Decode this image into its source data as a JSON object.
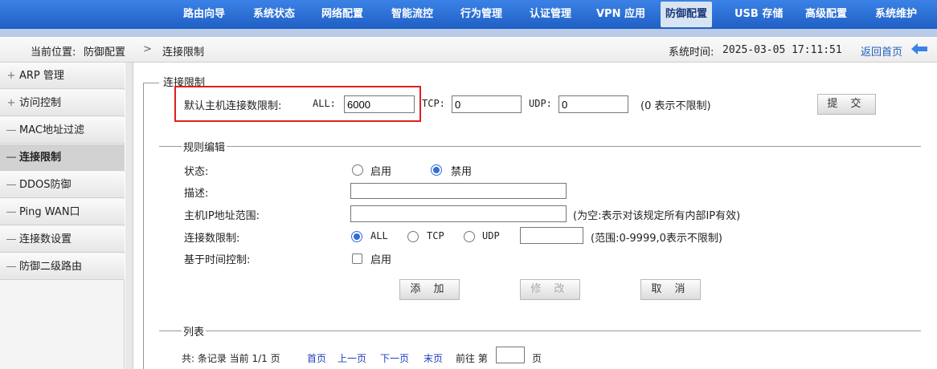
{
  "nav": {
    "items": [
      "路由向导",
      "系统状态",
      "网络配置",
      "智能流控",
      "行为管理",
      "认证管理",
      "VPN 应用",
      "防御配置",
      "USB 存储",
      "高级配置",
      "系统维护"
    ],
    "active": "防御配置"
  },
  "breadcrumb": {
    "prefix": "当前位置:",
    "section": "防御配置",
    "separator": ">",
    "page": "连接限制",
    "time_label": "系统时间:",
    "time_value": "2025-03-05 17:11:51",
    "home_link": "返回首页"
  },
  "sidebar": {
    "items": [
      {
        "sym": "+",
        "label": "ARP 管理"
      },
      {
        "sym": "+",
        "label": "访问控制"
      },
      {
        "sym": "—",
        "label": "MAC地址过滤"
      },
      {
        "sym": "—",
        "label": "连接限制"
      },
      {
        "sym": "—",
        "label": "DDOS防御"
      },
      {
        "sym": "—",
        "label": "Ping WAN口"
      },
      {
        "sym": "—",
        "label": "连接数设置"
      },
      {
        "sym": "—",
        "label": "防御二级路由"
      }
    ],
    "active_index": 3
  },
  "limit_section": {
    "legend": "连接限制",
    "default_label": "默认主机连接数限制:",
    "all_label": "ALL:",
    "all_value": "6000",
    "tcp_label": "TCP:",
    "tcp_value": "0",
    "udp_label": "UDP:",
    "udp_value": "0",
    "hint": "(0 表示不限制)",
    "submit_label": "提 交"
  },
  "rule_section": {
    "legend": "规则编辑",
    "status_label": "状态:",
    "enable_label": "启用",
    "disable_label": "禁用",
    "status_selected": "禁用",
    "desc_label": "描述:",
    "desc_value": "",
    "ip_label": "主机IP地址范围:",
    "ip_value": "",
    "ip_hint": "(为空:表示对该规定所有内部IP有效)",
    "conn_label": "连接数限制:",
    "proto_all": "ALL",
    "proto_tcp": "TCP",
    "proto_udp": "UDP",
    "proto_selected": "ALL",
    "conn_value": "",
    "conn_hint": "(范围:0-9999,0表示不限制)",
    "time_label": "基于时间控制:",
    "time_enable": "启用",
    "time_checked": false,
    "add_label": "添 加",
    "modify_label": "修 改",
    "cancel_label": "取 消"
  },
  "list_section": {
    "legend": "列表",
    "summary": "共: 条记录 当前 1/1 页",
    "first": "首页",
    "prev": "上一页",
    "next": "下一页",
    "last": "末页",
    "goto_label": "前往 第",
    "goto_value": "",
    "page_suffix": "页"
  },
  "colors": {
    "nav_bg": "#2a6fd6",
    "highlight": "#e02020",
    "link": "#2040c0"
  }
}
